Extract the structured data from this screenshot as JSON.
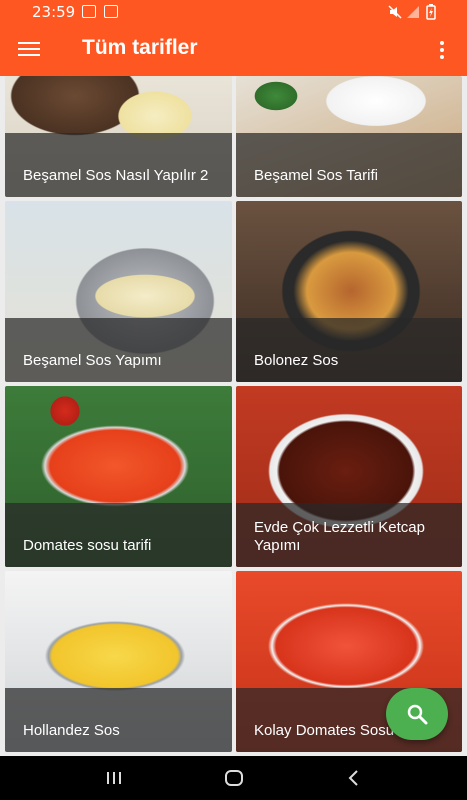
{
  "status_bar": {
    "time": "23:59",
    "icons": [
      "image-icon",
      "message-icon",
      "mute-icon",
      "signal-icon",
      "battery-charging-icon"
    ]
  },
  "app_bar": {
    "title": "Tüm tarifler",
    "menu_icon": "hamburger-menu-icon",
    "overflow_icon": "more-vert-icon"
  },
  "recipes": [
    {
      "title": "Beşamel Sos Nasıl Yapılır 2"
    },
    {
      "title": "Beşamel Sos Tarifi"
    },
    {
      "title": "Beşamel Sos Yapımı"
    },
    {
      "title": "Bolonez Sos"
    },
    {
      "title": "Domates sosu tarifi"
    },
    {
      "title": "Evde Çok Lezzetli Ketcap Yapımı"
    },
    {
      "title": "Hollandez Sos"
    },
    {
      "title": "Kolay Domates Sosu"
    }
  ],
  "fab": {
    "icon": "search-icon",
    "color": "#4caf50"
  },
  "nav_bar": {
    "icons": [
      "recent-apps-icon",
      "home-icon",
      "back-icon"
    ]
  },
  "colors": {
    "primary": "#ff5722",
    "fab": "#4caf50",
    "caption_overlay": "rgba(40,40,40,0.72)"
  }
}
